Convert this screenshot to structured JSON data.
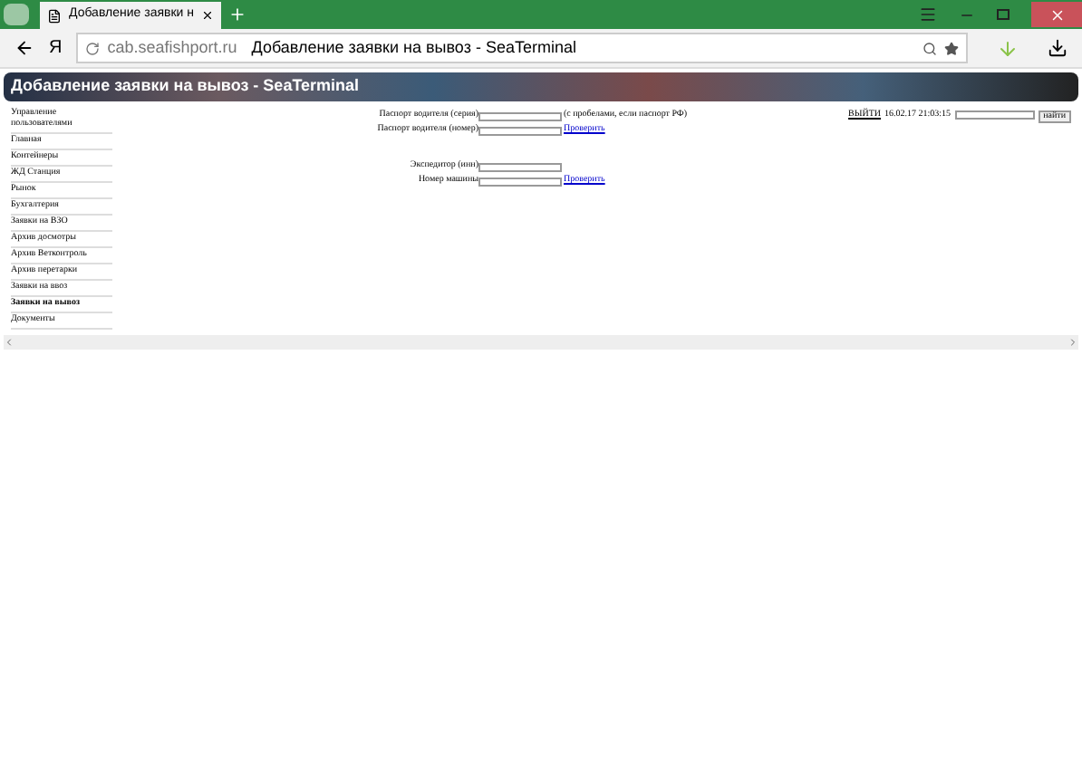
{
  "browser": {
    "tab_title": "Добавление заявки н",
    "address_host": "cab.seafishport.ru",
    "address_title": "Добавление заявки на вывоз - SeaTerminal",
    "yandex_label": "Я"
  },
  "banner": {
    "title": "Добавление заявки на вывоз - SeaTerminal"
  },
  "sidebar": {
    "items": [
      {
        "label": "Управление пользователями",
        "selected": false
      },
      {
        "label": "Главная",
        "selected": false
      },
      {
        "label": "Контейнеры",
        "selected": false
      },
      {
        "label": "ЖД Станция",
        "selected": false
      },
      {
        "label": "Рынок",
        "selected": false
      },
      {
        "label": "Бухгалтерия",
        "selected": false
      },
      {
        "label": "Заявки на ВЗО",
        "selected": false
      },
      {
        "label": "Архив досмотры",
        "selected": false
      },
      {
        "label": "Архив Ветконтроль",
        "selected": false
      },
      {
        "label": "Архив перетарки",
        "selected": false
      },
      {
        "label": "Заявки на ввоз",
        "selected": false
      },
      {
        "label": "Заявки на вывоз",
        "selected": true
      },
      {
        "label": "Документы",
        "selected": false
      }
    ]
  },
  "form": {
    "groups": [
      [
        {
          "label": "Паспорт водителя (серия)",
          "note": "(с пробелами, если паспорт РФ)"
        },
        {
          "label": "Паспорт водителя (номер)",
          "link": "Проверить"
        }
      ],
      [
        {
          "label": "Экспедитор (инн)"
        },
        {
          "label": "Номер машины",
          "link": "Проверить"
        }
      ]
    ]
  },
  "topright": {
    "logout": "ВЫЙТИ",
    "datetime": "16.02.17 21:03:15",
    "search_button": "найти"
  }
}
